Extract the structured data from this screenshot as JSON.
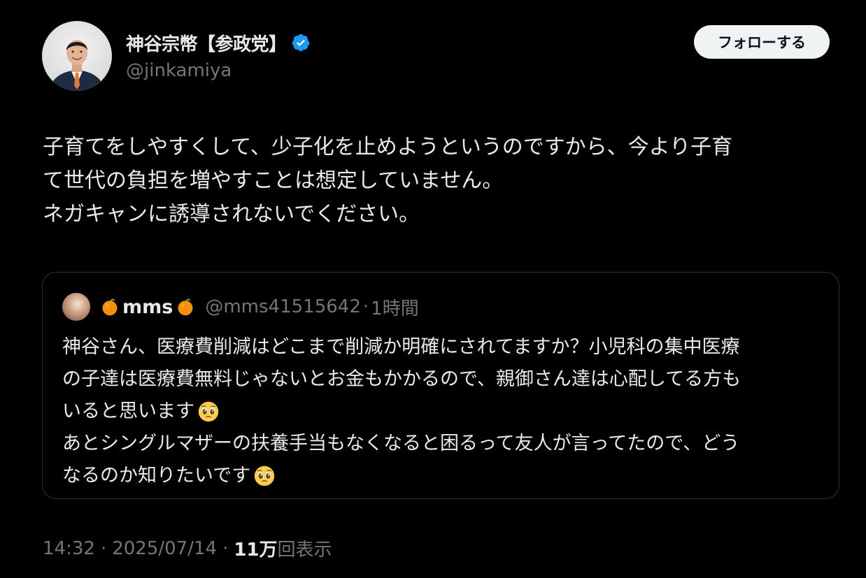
{
  "author": {
    "display_name": "神谷宗幣【参政党】",
    "handle": "@jinkamiya",
    "verified": true,
    "verified_color": "#1d9bf0"
  },
  "follow_button": {
    "label": "フォローする"
  },
  "tweet": {
    "lines": [
      "子育てをしやすくして、少子化を止めようというのですから、今より子育",
      "て世代の負担を増やすことは想定していません。",
      "ネガキャンに誘導されないでください。"
    ]
  },
  "quoted_tweet": {
    "name_prefix_emoji": "orange-emoji",
    "name": "mms",
    "name_suffix_emoji": "orange-emoji",
    "handle": "@mms41515642",
    "separator": "·",
    "time": "1時間",
    "lines": [
      "神谷さん、医療費削減はどこまで削減か明確にされてますか？小児科の集中医療",
      "の子達は医療費無料じゃないとお金もかかるので、親御さん達は心配してる方も",
      "いると思います",
      "あとシングルマザーの扶養手当もなくなると困るって友人が言ってたので、どう",
      "なるのか知りたいです"
    ],
    "line_emojis": [
      "",
      "",
      "pleading-face-emoji",
      "",
      "pleading-face-emoji"
    ]
  },
  "meta": {
    "time": "14:32",
    "separator": "·",
    "date": "2025/07/14",
    "views_count": "11万",
    "views_label": "回表示"
  },
  "colors": {
    "background": "#000000",
    "text_primary": "#e7e9ea",
    "text_secondary": "#71767b",
    "border": "#2f3336",
    "button_bg": "#eff3f4"
  }
}
